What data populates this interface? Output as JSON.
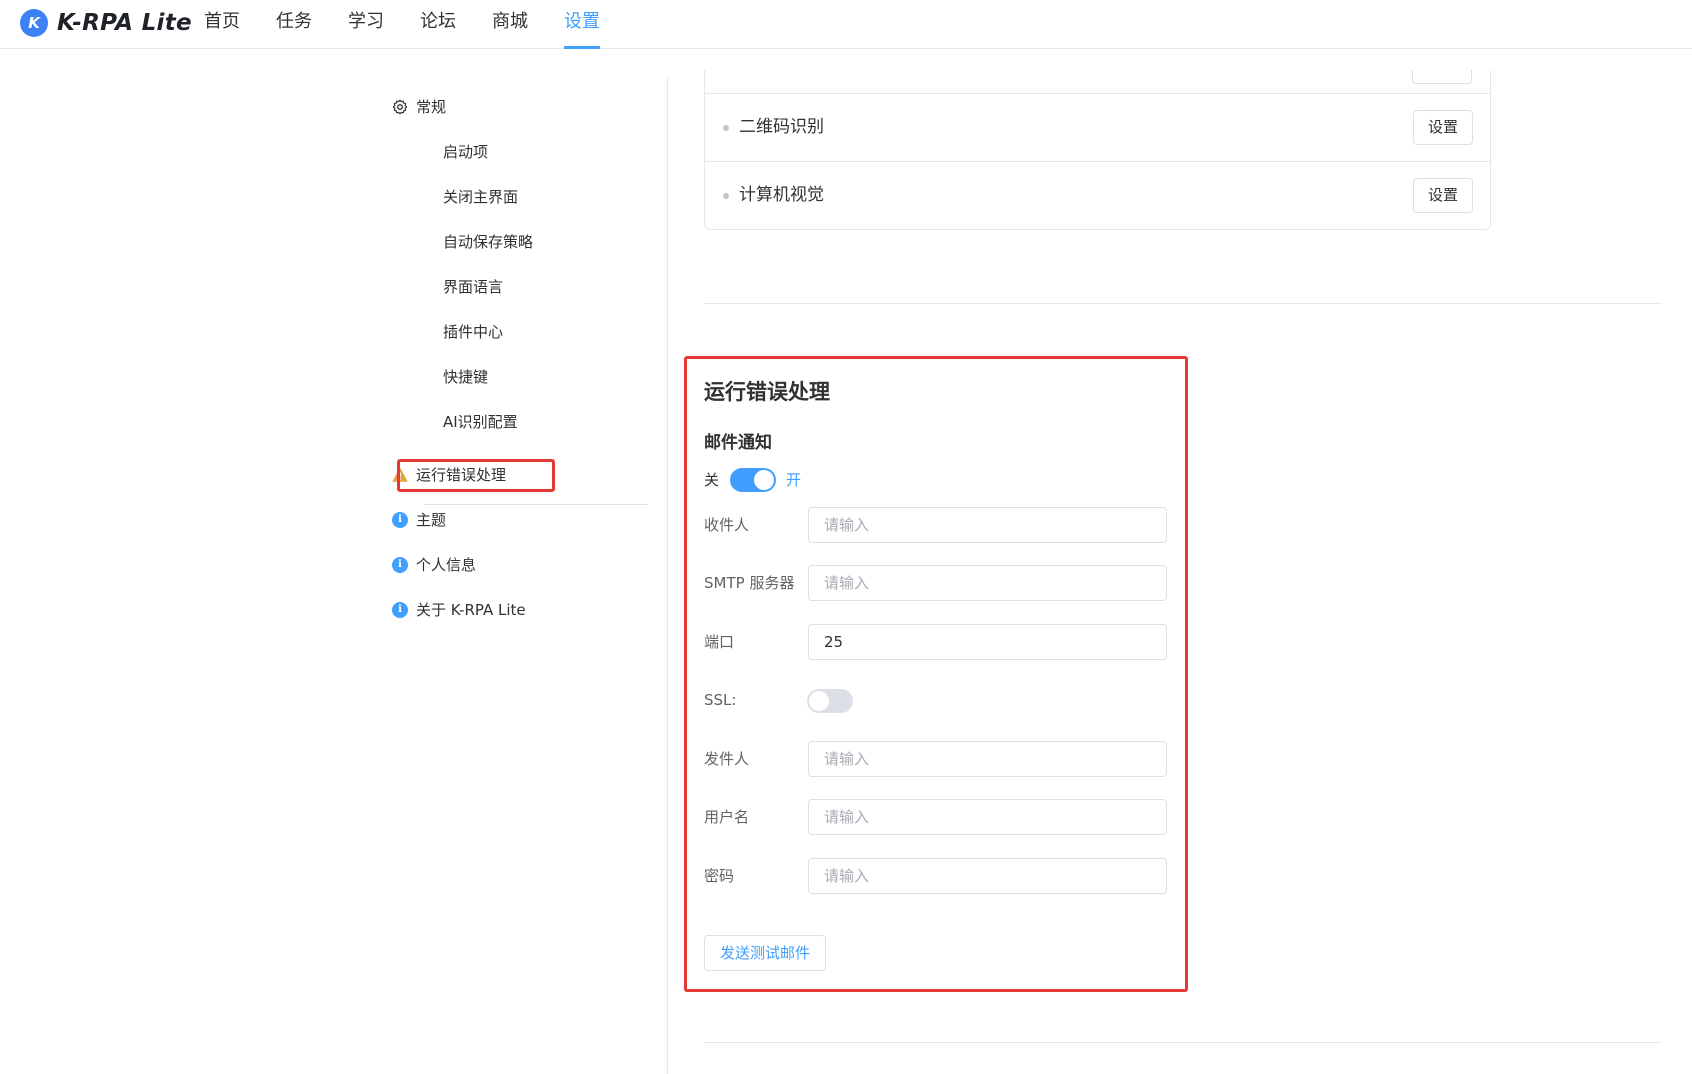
{
  "app": {
    "logo_letter": "K",
    "name": "K-RPA Lite"
  },
  "nav": [
    {
      "label": "首页",
      "active": false
    },
    {
      "label": "任务",
      "active": false
    },
    {
      "label": "学习",
      "active": false
    },
    {
      "label": "论坛",
      "active": false
    },
    {
      "label": "商城",
      "active": false
    },
    {
      "label": "设置",
      "active": true
    }
  ],
  "sidebar": {
    "general": {
      "label": "常规",
      "icon": "gear-icon"
    },
    "general_items": [
      "启动项",
      "关闭主界面",
      "自动保存策略",
      "界面语言",
      "插件中心",
      "快捷键",
      "AI识别配置"
    ],
    "error_handling": {
      "label": "运行错误处理",
      "icon": "warning-icon"
    },
    "others": [
      {
        "label": "主题",
        "icon": "info-icon"
      },
      {
        "label": "个人信息",
        "icon": "info-icon"
      },
      {
        "label": "关于 K-RPA Lite",
        "icon": "info-icon"
      }
    ]
  },
  "ai_card": {
    "rows": [
      {
        "label": "二维码识别",
        "button": "设置"
      },
      {
        "label": "计算机视觉",
        "button": "设置"
      }
    ]
  },
  "error_section": {
    "title": "运行错误处理",
    "email": {
      "title": "邮件通知",
      "switch_off_label": "关",
      "switch_on_label": "开",
      "enabled": true,
      "fields": {
        "recipient": {
          "label": "收件人",
          "value": "",
          "placeholder": "请输入"
        },
        "smtp": {
          "label": "SMTP 服务器",
          "value": "",
          "placeholder": "请输入"
        },
        "port": {
          "label": "端口",
          "value": "25",
          "placeholder": "请输入"
        },
        "ssl": {
          "label": "SSL:",
          "enabled": false
        },
        "sender": {
          "label": "发件人",
          "value": "",
          "placeholder": "请输入"
        },
        "username": {
          "label": "用户名",
          "value": "",
          "placeholder": "请输入"
        },
        "password": {
          "label": "密码",
          "value": "",
          "placeholder": "请输入"
        }
      },
      "test_button": "发送测试邮件"
    }
  },
  "colors": {
    "accent": "#409eff",
    "highlight": "#e53935",
    "warning": "#e6a23c",
    "border": "#dcdfe6"
  }
}
